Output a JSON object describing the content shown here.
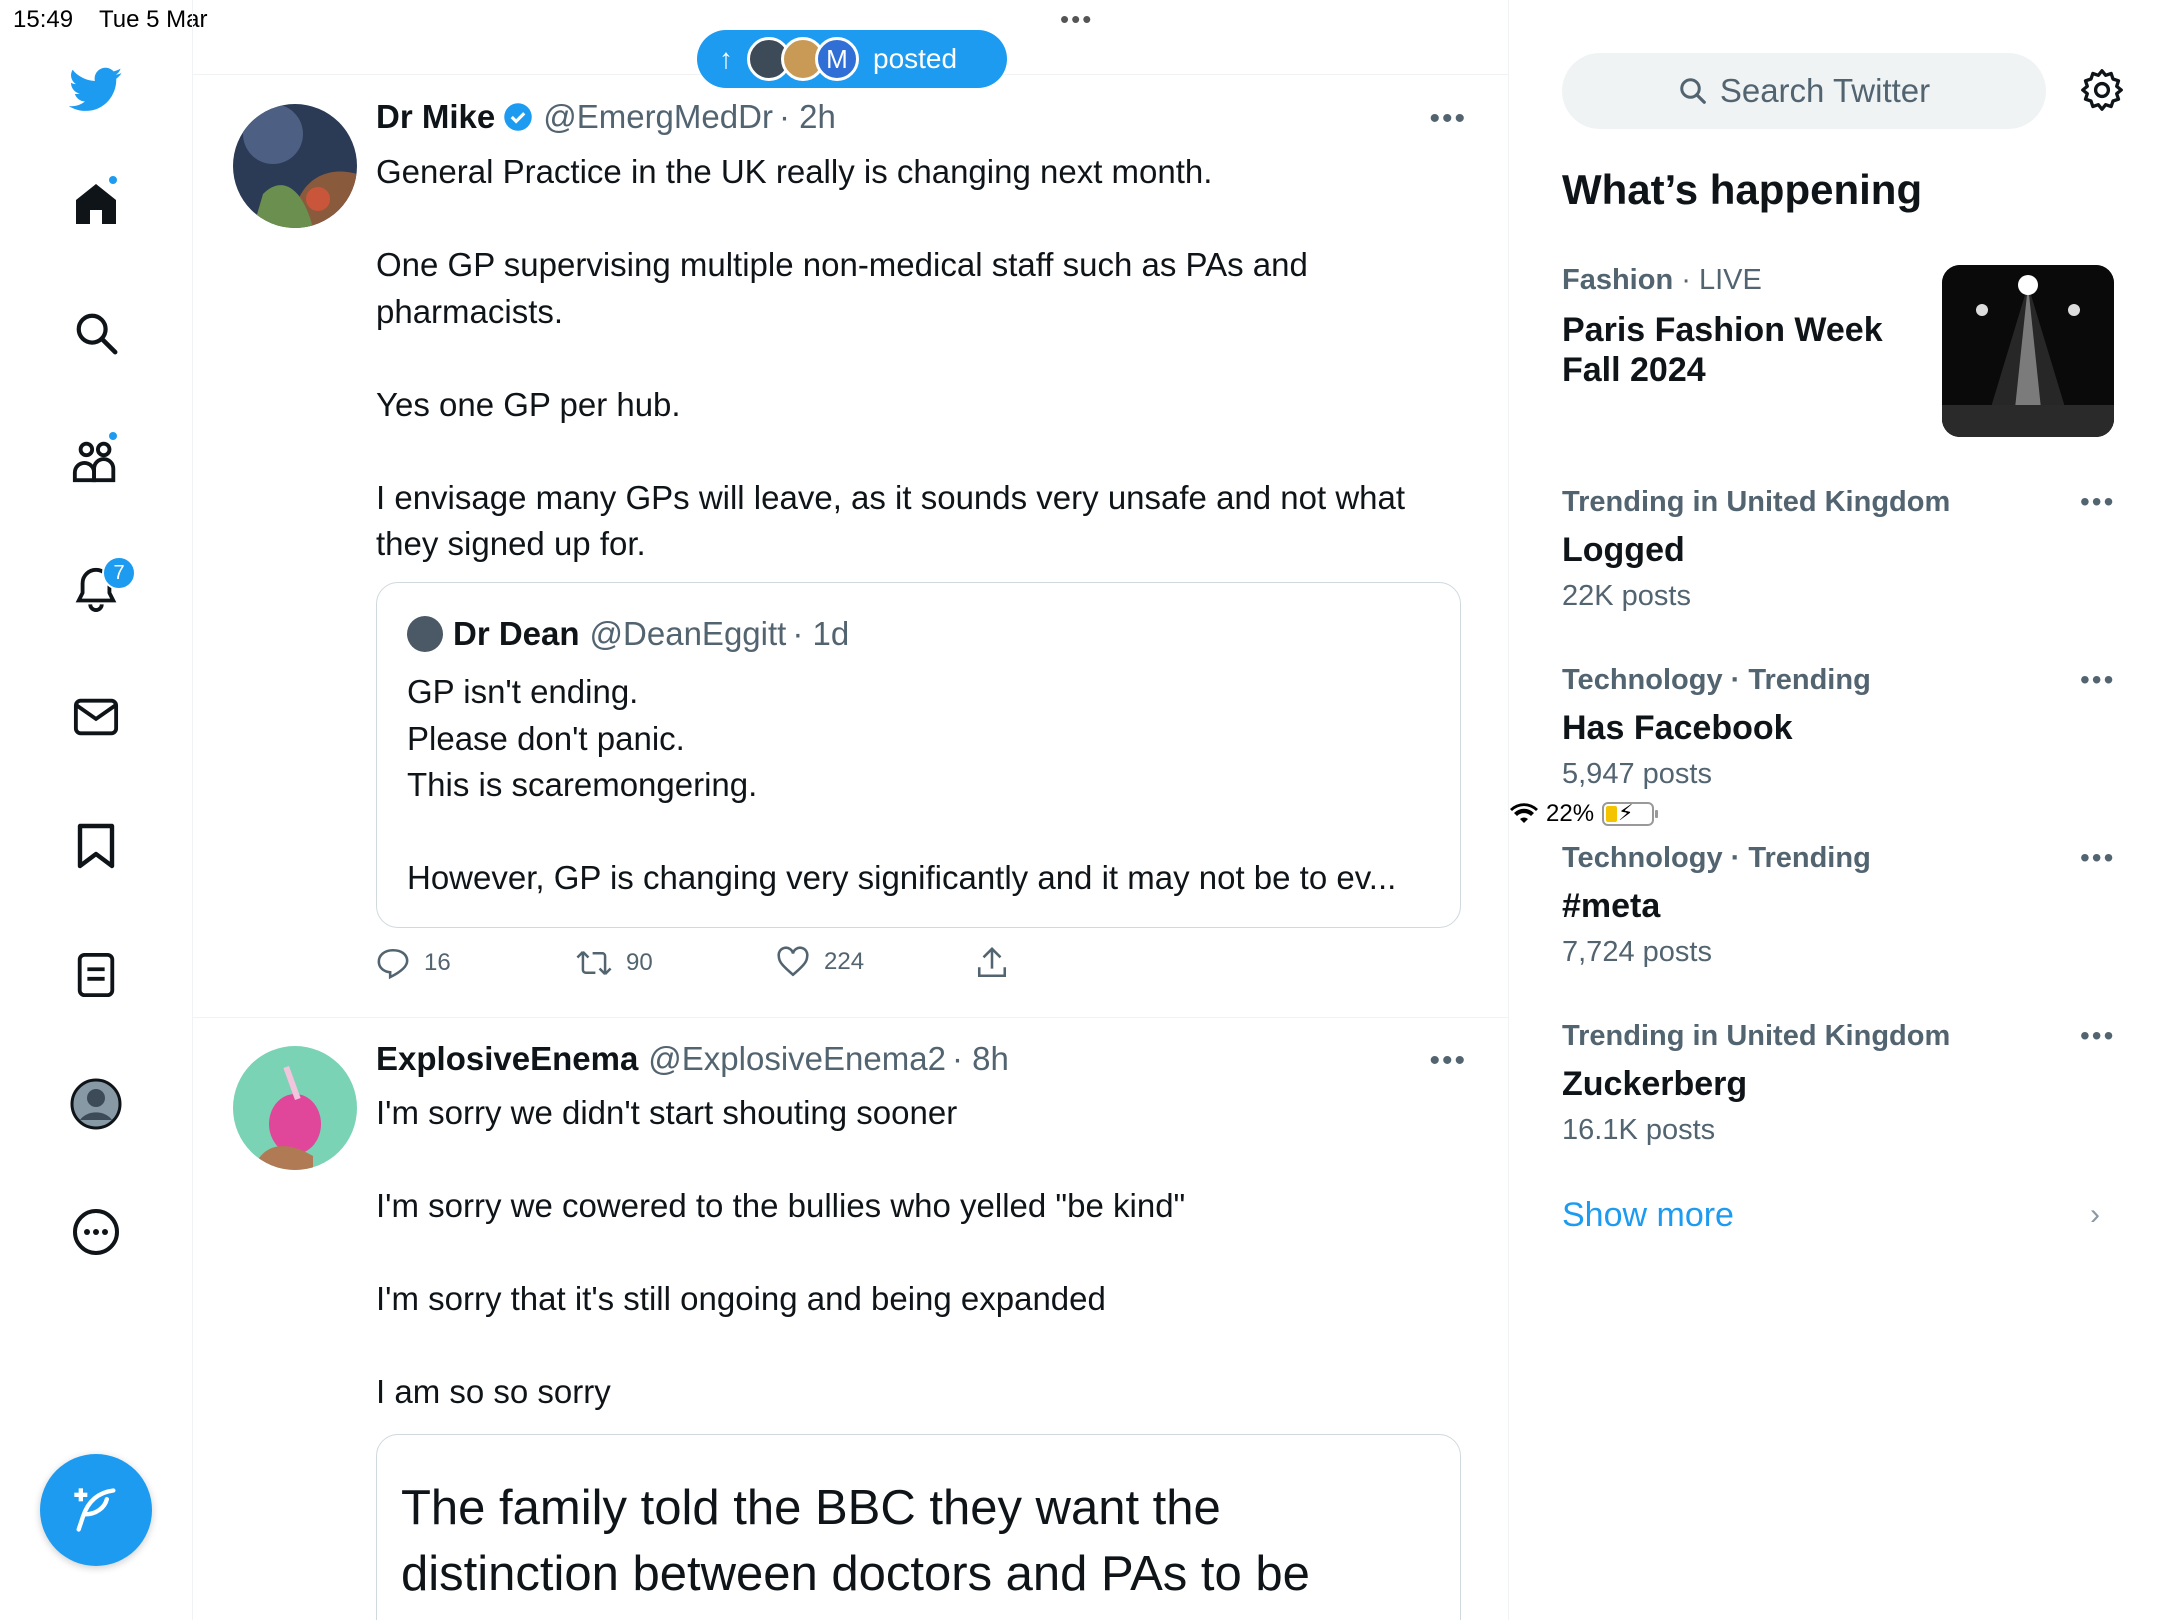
{
  "status_bar": {
    "time": "15:49",
    "date": "Tue 5 Mar",
    "battery": "22%",
    "battery_level": 0.22
  },
  "nav": {
    "items": [
      {
        "name": "twitter-logo",
        "icon": "twitter-bird-icon"
      },
      {
        "name": "home",
        "icon": "home-icon"
      },
      {
        "name": "explore",
        "icon": "search-icon"
      },
      {
        "name": "communities",
        "icon": "communities-icon"
      },
      {
        "name": "notifications",
        "icon": "bell-icon",
        "badge": "7"
      },
      {
        "name": "messages",
        "icon": "envelope-icon"
      },
      {
        "name": "bookmarks",
        "icon": "bookmark-icon"
      },
      {
        "name": "lists",
        "icon": "list-icon"
      },
      {
        "name": "profile",
        "icon": "avatar-icon"
      },
      {
        "name": "more",
        "icon": "more-icon"
      }
    ],
    "compose_icon": "compose-feather-icon"
  },
  "feed": {
    "posted_pill": {
      "label": "posted",
      "avatar_initial": "M"
    },
    "tweets": [
      {
        "name": "Dr Mike",
        "handle": "@EmergMedDr",
        "time": "· 2h",
        "verified": true,
        "body": [
          "General Practice in the UK really is changing next month.",
          "",
          "One GP supervising multiple non-medical staff such as PAs and pharmacists.",
          "",
          "Yes one GP per hub.",
          "",
          "I envisage many GPs will leave, as it sounds very unsafe and not what they signed up for."
        ],
        "quote": {
          "name": "Dr Dean",
          "handle": "@DeanEggitt",
          "time": "· 1d",
          "body": [
            "GP isn't ending.",
            "Please don't panic.",
            "This is scaremongering.",
            "",
            "However, GP is changing very significantly and it may not be to ev..."
          ]
        },
        "actions": {
          "replies": "16",
          "retweets": "90",
          "likes": "224"
        }
      },
      {
        "name": "ExplosiveEnema",
        "handle": "@ExplosiveEnema2",
        "time": "· 8h",
        "body": [
          "I'm sorry we didn't start shouting sooner",
          "",
          "I'm sorry we cowered to the bullies who yelled \"be kind\"",
          "",
          "I'm sorry that it's still ongoing and being expanded",
          "",
          "I am so so sorry"
        ],
        "card_headline": "The family told the BBC they want the distinction between doctors and PAs to be"
      }
    ]
  },
  "right": {
    "search_placeholder": "Search Twitter",
    "whats_happening": "What’s happening",
    "trends": [
      {
        "category": "Fashion",
        "status": "· LIVE",
        "title": "Paris Fashion Week Fall 2024"
      },
      {
        "category": "Trending in United Kingdom",
        "title": "Logged",
        "count": "22K posts"
      },
      {
        "category": "Technology · Trending",
        "title": "Has Facebook",
        "count": "5,947 posts"
      },
      {
        "category": "Technology · Trending",
        "title": "#meta",
        "count": "7,724 posts"
      },
      {
        "category": "Trending in United Kingdom",
        "title": "Zuckerberg",
        "count": "16.1K posts"
      }
    ],
    "show_more": "Show more"
  },
  "colors": {
    "accent": "#1d9bf0",
    "text": "#0f1419",
    "muted": "#536471",
    "border": "#cfd9de"
  }
}
